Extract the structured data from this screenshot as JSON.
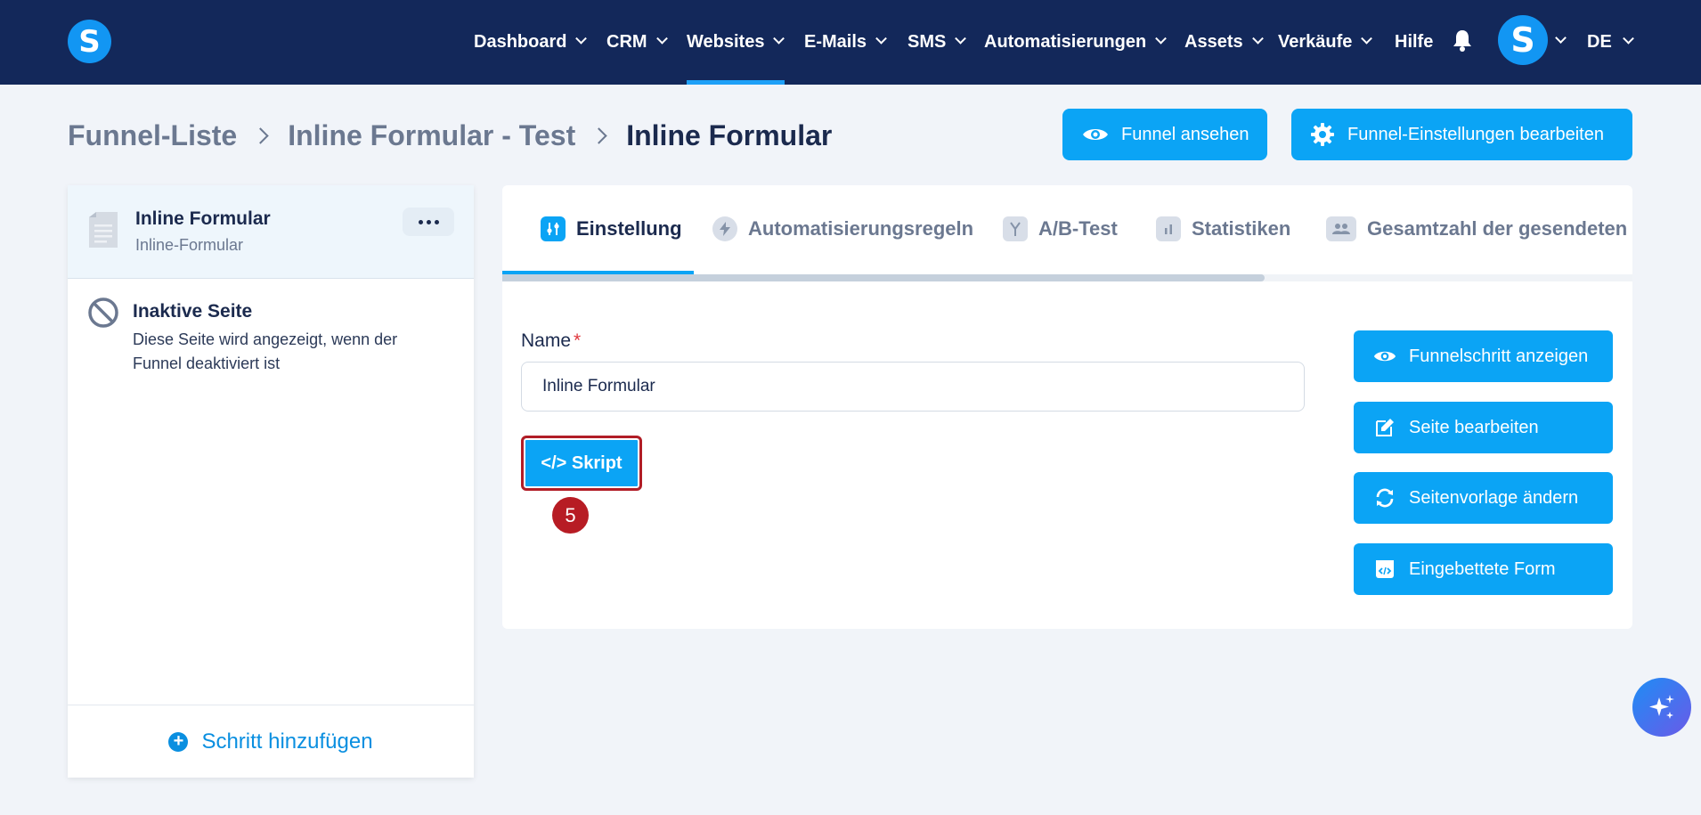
{
  "brand": {
    "logo_letter": "S",
    "avatar_letter": "S"
  },
  "nav": {
    "items": [
      {
        "label": "Dashboard"
      },
      {
        "label": "CRM"
      },
      {
        "label": "Websites"
      },
      {
        "label": "E-Mails"
      },
      {
        "label": "SMS"
      },
      {
        "label": "Automatisierungen"
      },
      {
        "label": "Assets"
      },
      {
        "label": "Verkäufe"
      },
      {
        "label": "Hilfe"
      }
    ],
    "active": "Websites",
    "language": "DE"
  },
  "breadcrumb": {
    "items": [
      "Funnel-Liste",
      "Inline Formular - Test",
      "Inline Formular"
    ]
  },
  "header_buttons": {
    "view_funnel": "Funnel ansehen",
    "edit_funnel_settings": "Funnel-Einstellungen bearbeiten"
  },
  "sidebar": {
    "selected_step": {
      "title": "Inline Formular",
      "subtitle": "Inline-Formular"
    },
    "inactive_page": {
      "title": "Inaktive Seite",
      "description": "Diese Seite wird angezeigt, wenn der Funnel deaktiviert ist"
    },
    "add_step_label": "Schritt hinzufügen"
  },
  "tabs": [
    {
      "label": "Einstellung",
      "icon": "sliders-icon",
      "active": true
    },
    {
      "label": "Automatisierungsregeln",
      "icon": "bolt-icon"
    },
    {
      "label": "A/B-Test",
      "icon": "split-icon"
    },
    {
      "label": "Statistiken",
      "icon": "bar-chart-icon"
    },
    {
      "label": "Gesamtzahl der gesendeten L",
      "icon": "users-icon"
    }
  ],
  "form": {
    "name_label": "Name",
    "required_mark": "*",
    "name_value": "Inline Formular",
    "script_button": "</> Skript",
    "step_marker": "5"
  },
  "actions": {
    "show_step": "Funnelschritt anzeigen",
    "edit_page": "Seite bearbeiten",
    "change_template": "Seitenvorlage ändern",
    "embedded_form": "Eingebettete Form"
  },
  "colors": {
    "topbar": "#13285a",
    "primary": "#0ba4f5",
    "highlight_border": "#b11d26",
    "badge": "#b71c24"
  }
}
